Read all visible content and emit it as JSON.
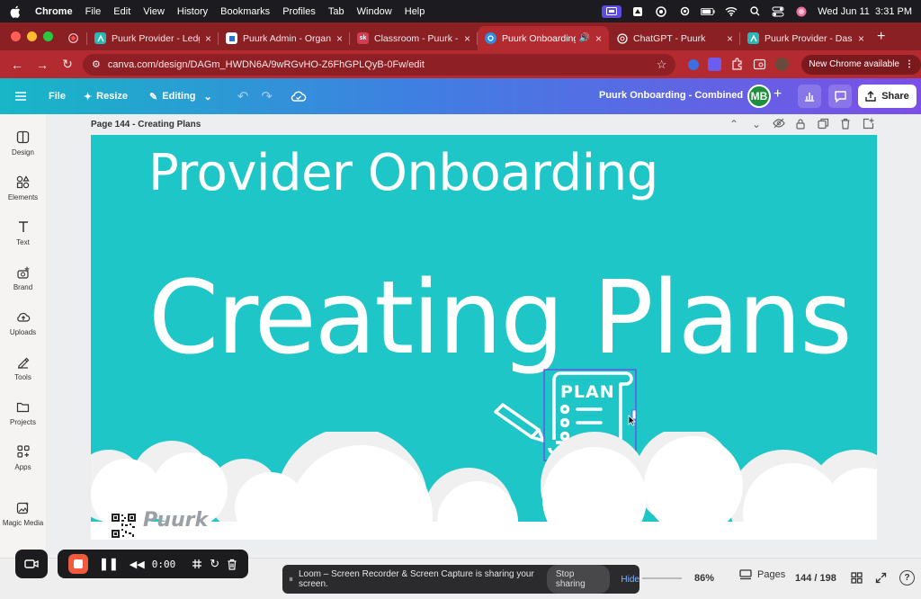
{
  "menubar": {
    "app": "Chrome",
    "items": [
      "File",
      "Edit",
      "View",
      "History",
      "Bookmarks",
      "Profiles",
      "Tab",
      "Window",
      "Help"
    ],
    "datetime": "Wed Jun 11  3:31 PM"
  },
  "tabs": [
    {
      "title": "",
      "favicon": "record-icon",
      "color": "#e04848"
    },
    {
      "title": "Puurk Provider - Ledger",
      "favicon": "puurk-icon",
      "color": "#2bb6b8"
    },
    {
      "title": "Puurk Admin - Organizat",
      "favicon": "puurk-admin-icon",
      "color": "#ffffff"
    },
    {
      "title": "Classroom - Puurk - Co",
      "favicon": "classroom-icon",
      "color": "#d53b55"
    },
    {
      "title": "Puurk Onboarding -",
      "favicon": "canva-icon",
      "color": "#2f8ee0",
      "active": true
    },
    {
      "title": "ChatGPT - Puurk",
      "favicon": "chatgpt-icon",
      "color": "#ffffff"
    },
    {
      "title": "Puurk Provider - Dashbo",
      "favicon": "puurk-icon",
      "color": "#2bb6b8"
    }
  ],
  "address": {
    "url": "canva.com/design/DAGm_HWDN6A/9wRGvHO-Z6FhGPLQyB-0Fw/edit",
    "update_label": "New Chrome available"
  },
  "canva_bar": {
    "file": "File",
    "resize": "Resize",
    "editing": "Editing",
    "doc_title": "Puurk Onboarding - Combined",
    "avatar": "MB",
    "share": "Share"
  },
  "rail": [
    {
      "label": "Design",
      "icon": "design-icon"
    },
    {
      "label": "Elements",
      "icon": "elements-icon"
    },
    {
      "label": "Text",
      "icon": "text-icon"
    },
    {
      "label": "Brand",
      "icon": "brand-icon"
    },
    {
      "label": "Uploads",
      "icon": "uploads-icon"
    },
    {
      "label": "Tools",
      "icon": "tools-icon"
    },
    {
      "label": "Projects",
      "icon": "projects-icon"
    },
    {
      "label": "Apps",
      "icon": "apps-icon"
    },
    {
      "label": "Magic Media",
      "icon": "magic-media-icon"
    }
  ],
  "page": {
    "label": "Page 144 - Creating Plans"
  },
  "slide": {
    "heading": "Provider Onboarding",
    "title": "Creating Plans",
    "plan_label": "PLAN",
    "brand": "Puurk",
    "background": "#1fc6c7"
  },
  "bottom": {
    "zoom": "86%",
    "pages_label": "Pages",
    "page_count": "144 / 198",
    "help": "?"
  },
  "loom": {
    "time": "0:00",
    "sharing_text": "Loom – Screen Recorder & Screen Capture is sharing your screen.",
    "stop_sharing": "Stop sharing",
    "hide": "Hide"
  }
}
